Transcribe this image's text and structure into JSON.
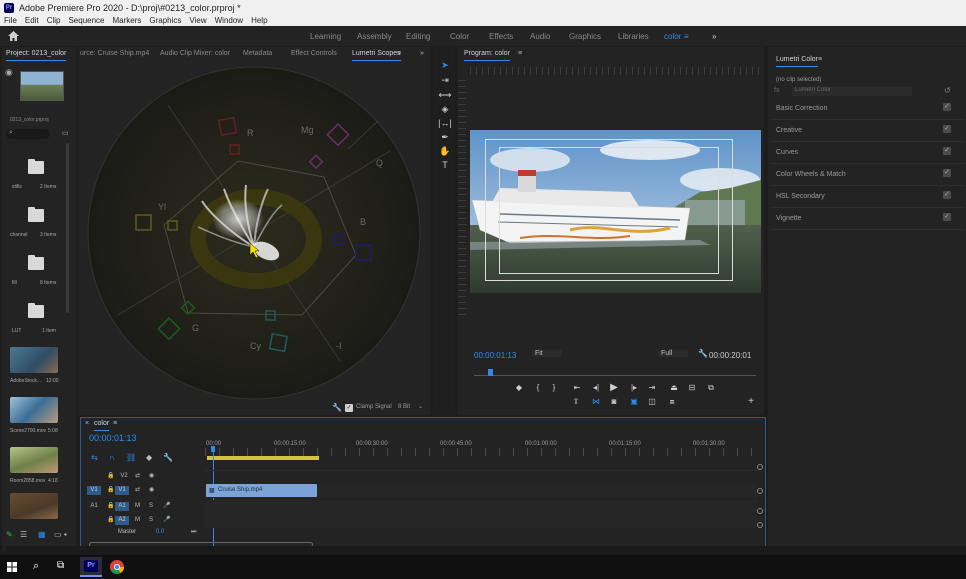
{
  "app": {
    "title": "Adobe Premiere Pro 2020 - D:\\proj\\#0213_color.prproj *",
    "logo_text": "Pr"
  },
  "menu": [
    "File",
    "Edit",
    "Clip",
    "Sequence",
    "Markers",
    "Graphics",
    "View",
    "Window",
    "Help"
  ],
  "workspaces": [
    {
      "label": "Learning"
    },
    {
      "label": "Assembly"
    },
    {
      "label": "Editing"
    },
    {
      "label": "Color"
    },
    {
      "label": "Effects"
    },
    {
      "label": "Audio"
    },
    {
      "label": "Graphics"
    },
    {
      "label": "Libraries"
    },
    {
      "label": "color",
      "active": true
    }
  ],
  "project": {
    "tab": "Project: 0213_color",
    "file": "0213_color.prproj",
    "bins": [
      {
        "name": "stills",
        "count": "2 Items"
      },
      {
        "name": "channel",
        "count": "3 Items"
      },
      {
        "name": "fill",
        "count": "8 Items"
      },
      {
        "name": "LUT",
        "count": "1 Item"
      }
    ],
    "media": [
      {
        "name": "AdobeStock...",
        "duration": "12:00",
        "color": "#5b7f96"
      },
      {
        "name": "Scene2700.mov",
        "duration": "5:08",
        "color": "#4d6f8b"
      },
      {
        "name": "Room2858.mov",
        "duration": "4:18",
        "color": "#7a8a52"
      },
      {
        "name": "",
        "duration": "",
        "color": "#7a5a3a"
      }
    ]
  },
  "source_tabs": [
    "urce: Cruise Ship.mp4",
    "Audio Clip Mixer: color",
    "Metadata",
    "Effect Controls",
    "Lumetri Scopes"
  ],
  "scope": {
    "labels": {
      "R": "R",
      "Mg": "Mg",
      "B": "B",
      "Cy": "Cy",
      "G": "G",
      "Yl": "Yl",
      "Q": "Q",
      "I": "-I"
    },
    "clamp_label": "Clamp Signal",
    "bit_depth": "8 Bit"
  },
  "program": {
    "tab": "Program: color",
    "timecode": "00:00:01:13",
    "fit": "Fit",
    "quality": "Full",
    "duration": "00:00:20:01"
  },
  "lumetri": {
    "tab": "Lumetri Color",
    "no_clip": "(no clip selected)",
    "dropdown": "Lumetri Color",
    "sections": [
      "Basic Correction",
      "Creative",
      "Curves",
      "Color Wheels & Match",
      "HSL Secondary",
      "Vignette"
    ]
  },
  "timeline": {
    "tab": "color",
    "timecode": "00:00:01:13",
    "ruler": [
      "00:00",
      "00:00:15:00",
      "00:00:30:00",
      "00:00:45:00",
      "00:01:00:00",
      "00:01:15:00",
      "00:01:30:00"
    ],
    "tracks": [
      {
        "name": "V2",
        "src": ""
      },
      {
        "name": "V1",
        "src": "V1"
      },
      {
        "name": "A1",
        "src": "A1"
      },
      {
        "name": "A2",
        "src": ""
      }
    ],
    "clip_name": "Cruise Ship.mp4",
    "master_label": "Master",
    "master_value": "0.0"
  },
  "taskbar": {
    "apps": [
      "start-icon",
      "search-icon",
      "taskview-icon",
      "premiere-icon",
      "chrome-icon"
    ],
    "premiere_label": "Pr"
  },
  "colors": {
    "accent": "#2d8ceb",
    "panel": "#232323",
    "bg": "#1d1d1d"
  }
}
